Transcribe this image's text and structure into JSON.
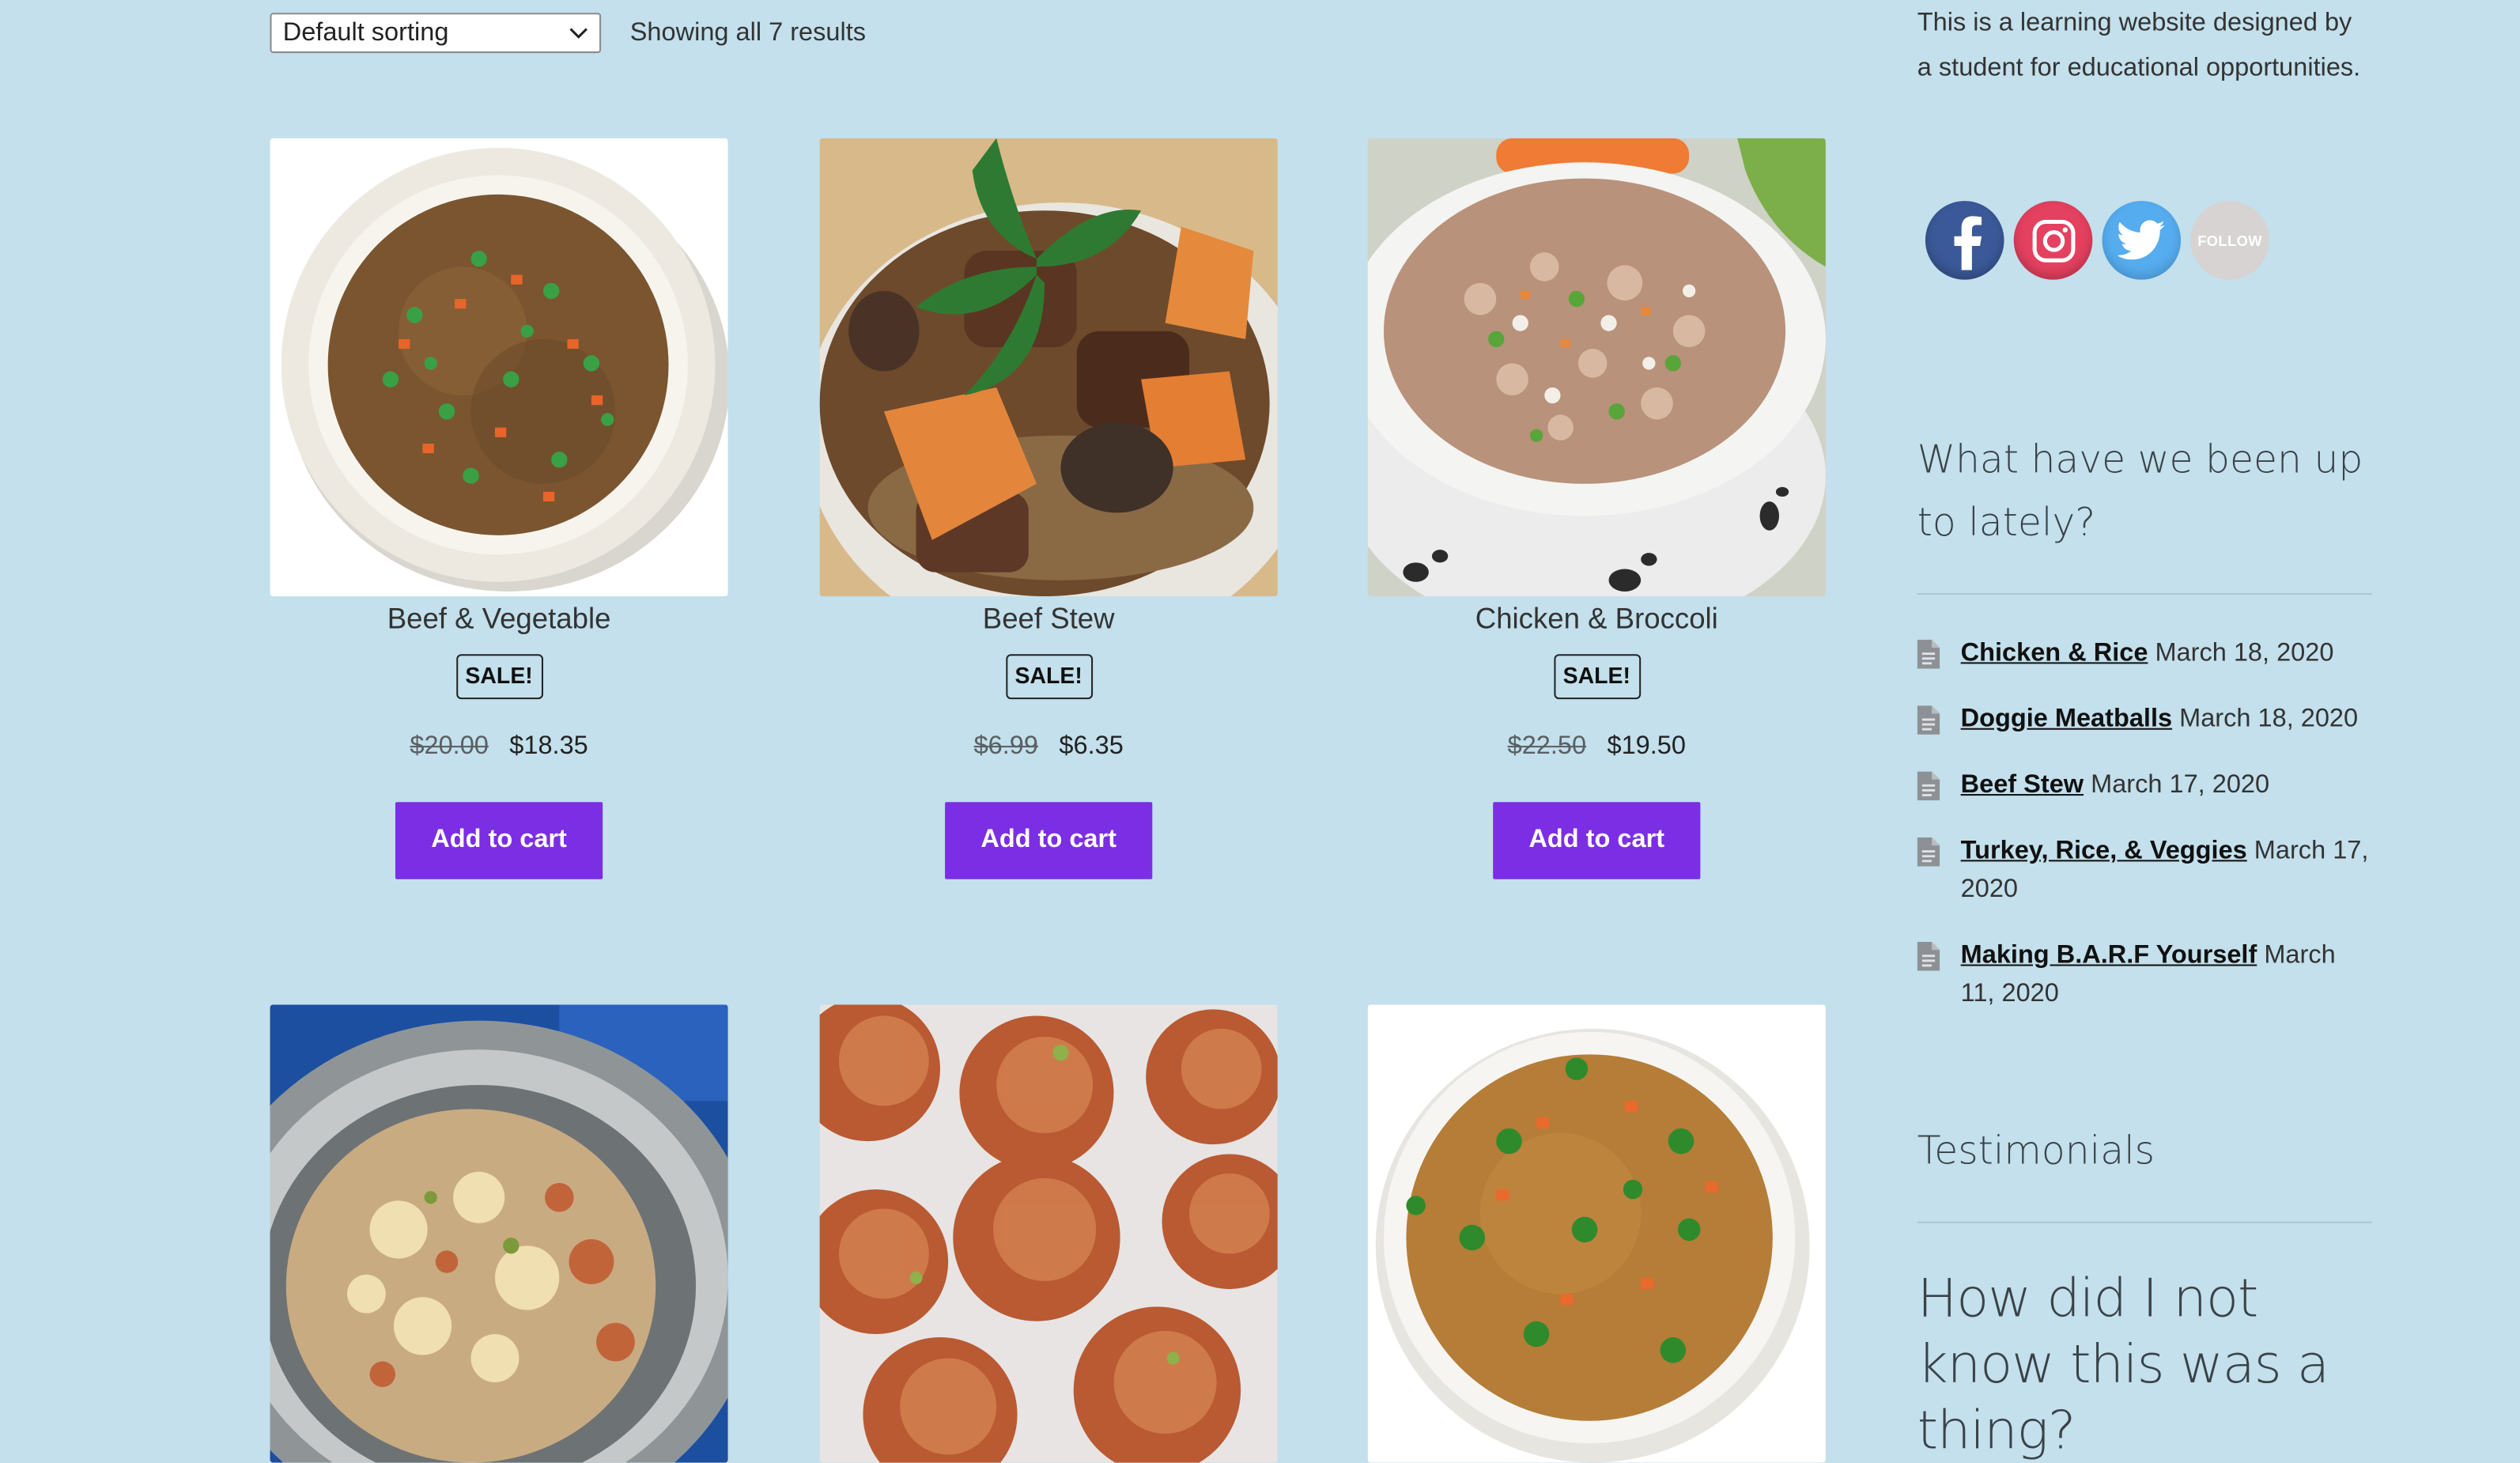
{
  "sorting": {
    "selected": "Default sorting"
  },
  "results": {
    "count_text": "Showing all 7 results"
  },
  "products": [
    {
      "name": "Beef & Vegetable",
      "badge": "SALE!",
      "old_price": "$20.00",
      "price": "$18.35",
      "button": "Add to cart"
    },
    {
      "name": "Beef Stew",
      "badge": "SALE!",
      "old_price": "$6.99",
      "price": "$6.35",
      "button": "Add to cart"
    },
    {
      "name": "Chicken & Broccoli",
      "badge": "SALE!",
      "old_price": "$22.50",
      "price": "$19.50",
      "button": "Add to cart"
    },
    {
      "name": "",
      "badge": "",
      "old_price": "",
      "price": "",
      "button": ""
    },
    {
      "name": "",
      "badge": "",
      "old_price": "",
      "price": "",
      "button": ""
    },
    {
      "name": "",
      "badge": "",
      "old_price": "",
      "price": "",
      "button": ""
    }
  ],
  "sidebar": {
    "about": "This is a learning website designed by a student for educational opportunities.",
    "social": {
      "follow_label": "FOLLOW",
      "icons": [
        "facebook-icon",
        "instagram-icon",
        "twitter-icon",
        "follow-icon"
      ]
    },
    "recent_title": "What have we been up to lately?",
    "posts": [
      {
        "title": "Chicken & Rice",
        "date": "March 18, 2020"
      },
      {
        "title": "Doggie Meatballs",
        "date": "March 18, 2020"
      },
      {
        "title": "Beef Stew",
        "date": "March 17, 2020"
      },
      {
        "title": "Turkey, Rice, & Veggies",
        "date": "March 17, 2020"
      },
      {
        "title": "Making B.A.R.F Yourself",
        "date": "March 11, 2020"
      }
    ],
    "testimonials_title": "Testimonials",
    "testimonial_quote": "How did I not know this was a thing?"
  },
  "colors": {
    "page_background": "#c3e0ec",
    "button": "#7b2ee4",
    "facebook": "#3b5998",
    "instagram": "#e4405f",
    "twitter": "#55acee"
  }
}
